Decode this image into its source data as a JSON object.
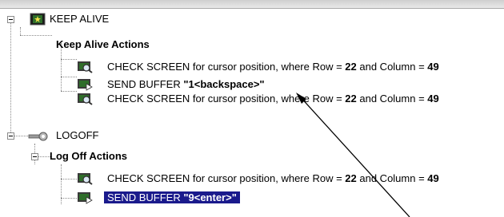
{
  "tree": {
    "keep_alive": {
      "label": "KEEP ALIVE",
      "group_label": "Keep Alive Actions",
      "items": [
        {
          "pre": "CHECK SCREEN for cursor position, where Row = ",
          "row": "22",
          "mid": " and Column = ",
          "col": "49"
        },
        {
          "pre": "SEND BUFFER ",
          "val": "\"1<backspace>\""
        },
        {
          "pre": "CHECK SCREEN for cursor position, where Row = ",
          "row": "22",
          "mid": " and Column = ",
          "col": "49"
        }
      ]
    },
    "logoff": {
      "label": "LOGOFF",
      "group_label": "Log Off Actions",
      "items": [
        {
          "pre": "CHECK SCREEN for cursor position, where Row = ",
          "row": "22",
          "mid": " and Column = ",
          "col": "49"
        },
        {
          "pre": "SEND BUFFER ",
          "val": "\"9<enter>\""
        }
      ]
    }
  },
  "colors": {
    "selection": "#1a1a8c",
    "tree_lines": "#8a8a8a"
  }
}
